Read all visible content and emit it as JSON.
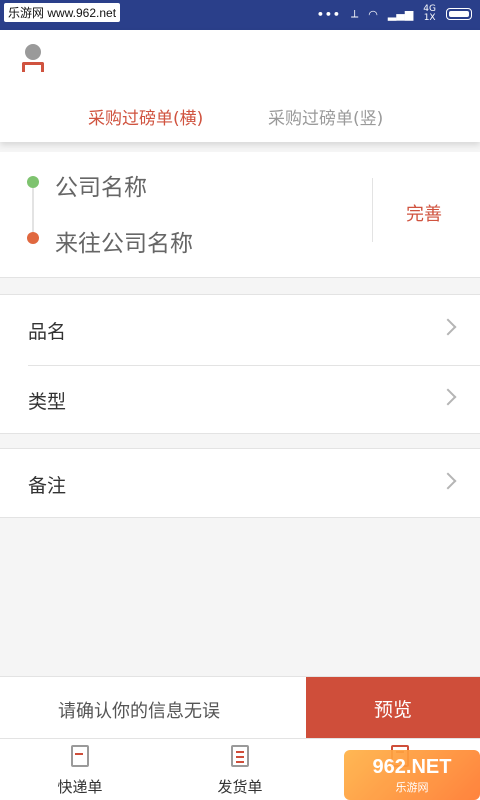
{
  "status_bar": {
    "watermark": "乐游网 www.962.net",
    "network": "4G",
    "network_sub": "1X"
  },
  "header": {
    "tabs": [
      {
        "label": "采购过磅单(横)",
        "active": true
      },
      {
        "label": "采购过磅单(竖)",
        "active": false
      }
    ]
  },
  "company": {
    "company_name": "公司名称",
    "counterparty_name": "来往公司名称",
    "complete_label": "完善"
  },
  "list": {
    "group1": [
      {
        "label": "品名"
      },
      {
        "label": "类型"
      }
    ],
    "group2": [
      {
        "label": "备注"
      }
    ]
  },
  "confirm": {
    "text": "请确认你的信息无误",
    "preview_label": "预览"
  },
  "bottom_nav": [
    {
      "label": "快递单"
    },
    {
      "label": "发货单"
    }
  ],
  "corner_watermark": {
    "big": "962.NET",
    "small": "乐游网"
  },
  "colors": {
    "accent": "#cf4e3a",
    "status_bar": "#2a3f8a",
    "dot_green": "#7ec36f",
    "dot_orange": "#e0683f"
  }
}
